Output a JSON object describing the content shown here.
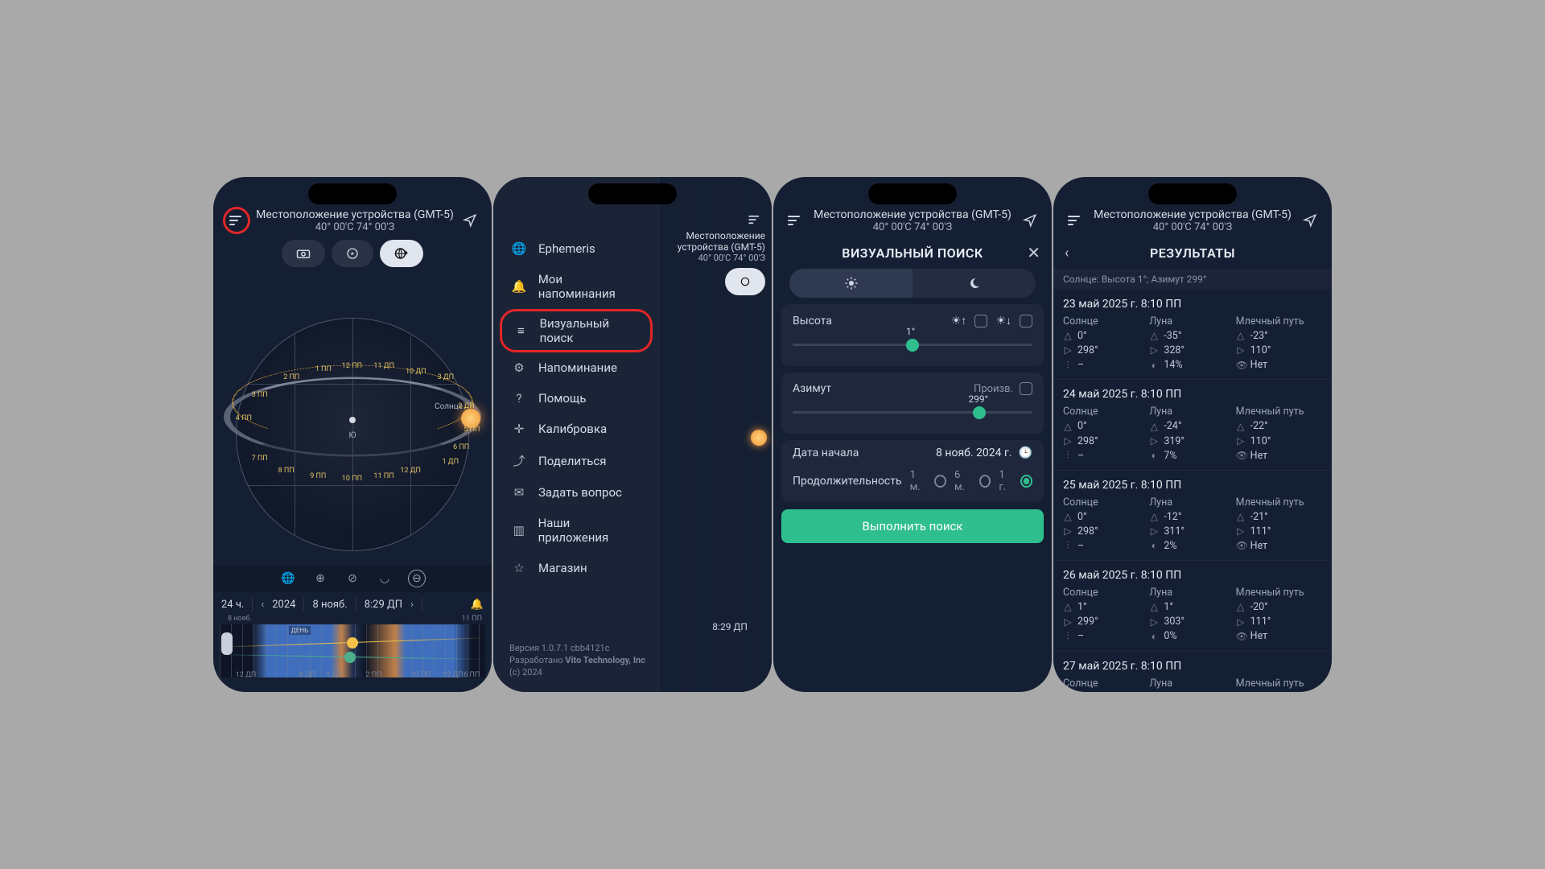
{
  "header": {
    "title": "Местоположение устройства (GMT-5)",
    "coords": "40° 00'С 74° 00'З"
  },
  "screen1": {
    "timebar": {
      "range": "24 ч.",
      "year": "2024",
      "date": "8 нояб.",
      "time": "8:29 ДП"
    },
    "hours": [
      "1 ПП",
      "12 ПП",
      "11 ДП",
      "10 ДП",
      "2 ПП",
      "3 ПП",
      "4 ПП",
      "5 ПП",
      "6 ПП",
      "7 ПП",
      "8 ПП",
      "9 ПП",
      "10 ПП",
      "11 ПП",
      "12 ДП",
      "1 ДП",
      "2 ДП",
      "3 ДП"
    ],
    "sun_label": "Солнце",
    "compass": "Ю",
    "timeline_labels": {
      "top_left": "8 нояб.",
      "top_mid": "ДЕНЬ",
      "bot": [
        "12 ДП",
        "8 ДП",
        "9 ДП",
        "2 ПП",
        "10 ПП",
        "12 ДП",
        "6 ПП"
      ],
      "top_r": "11 ПП"
    }
  },
  "menu": {
    "items": [
      {
        "icon": "globe",
        "label": "Ephemeris"
      },
      {
        "icon": "bell",
        "label": "Мои напоминания"
      },
      {
        "icon": "sliders",
        "label": "Визуальный поиск",
        "highlight": true
      },
      {
        "icon": "gear",
        "label": "Напоминание"
      },
      {
        "icon": "help",
        "label": "Помощь"
      },
      {
        "icon": "calibrate",
        "label": "Калибровка"
      },
      {
        "icon": "share",
        "label": "Поделиться"
      },
      {
        "icon": "mail",
        "label": "Задать вопрос"
      },
      {
        "icon": "apps",
        "label": "Наши приложения"
      },
      {
        "icon": "star",
        "label": "Магазин"
      }
    ],
    "about": {
      "ver": "Версия 1.0.7.1 cbb4121c",
      "dev": "Разработано Vito Technology, Inc",
      "cpr": "(c) 2024"
    },
    "ghost_time": "8:29 ДП"
  },
  "search": {
    "title": "ВИЗУАЛЬНЫЙ ПОИСК",
    "altitude": {
      "label": "Высота",
      "value": "1°",
      "pos": 50
    },
    "azimuth": {
      "label": "Азимут",
      "arbitrary": "Произв.",
      "value": "299°",
      "pos": 78
    },
    "startdate": {
      "label": "Дата начала",
      "value": "8 нояб. 2024 г."
    },
    "duration": {
      "label": "Продолжительность",
      "opts": [
        "1 м.",
        "6 м.",
        "1 г."
      ],
      "sel": 2
    },
    "button": "Выполнить поиск"
  },
  "results": {
    "title": "РЕЗУЛЬТАТЫ",
    "subtitle": "Солнце: Высота 1°; Азимут 299°",
    "items": [
      {
        "date": "23 май 2025 г. 8:10 ПП",
        "sun": {
          "alt": "0°",
          "az": "298°",
          "flag": "–"
        },
        "moon": {
          "alt": "-35°",
          "az": "328°",
          "ill": "14%"
        },
        "mw": {
          "alt": "-23°",
          "az": "110°",
          "vis": "Нет"
        }
      },
      {
        "date": "24 май 2025 г. 8:10 ПП",
        "sun": {
          "alt": "0°",
          "az": "298°",
          "flag": "–"
        },
        "moon": {
          "alt": "-24°",
          "az": "319°",
          "ill": "7%"
        },
        "mw": {
          "alt": "-22°",
          "az": "110°",
          "vis": "Нет"
        }
      },
      {
        "date": "25 май 2025 г. 8:10 ПП",
        "sun": {
          "alt": "0°",
          "az": "298°",
          "flag": "–"
        },
        "moon": {
          "alt": "-12°",
          "az": "311°",
          "ill": "2%"
        },
        "mw": {
          "alt": "-21°",
          "az": "111°",
          "vis": "Нет"
        }
      },
      {
        "date": "26 май 2025 г. 8:10 ПП",
        "sun": {
          "alt": "1°",
          "az": "299°",
          "flag": "–"
        },
        "moon": {
          "alt": "1°",
          "az": "303°",
          "ill": "0%"
        },
        "mw": {
          "alt": "-20°",
          "az": "111°",
          "vis": "Нет"
        }
      },
      {
        "date": "27 май 2025 г. 8:10 ПП",
        "sun": {
          "alt": "",
          "az": "",
          "flag": ""
        },
        "moon": {
          "alt": "",
          "az": "",
          "ill": ""
        },
        "mw": {
          "alt": "",
          "az": "",
          "vis": ""
        }
      }
    ],
    "colheads": {
      "sun": "Солнце",
      "moon": "Луна",
      "mw": "Млечный путь"
    }
  }
}
